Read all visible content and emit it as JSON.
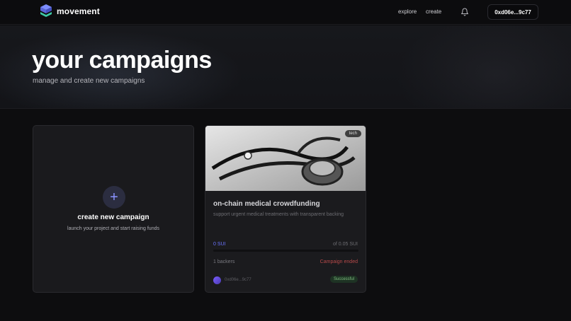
{
  "nav": {
    "brand": "movement",
    "links": [
      {
        "label": "explore"
      },
      {
        "label": "create"
      }
    ],
    "wallet": "0xd06e...9c77"
  },
  "hero": {
    "title": "your campaigns",
    "subtitle": "manage and create new campaigns"
  },
  "create_card": {
    "title": "create new campaign",
    "subtitle": "launch your project and start raising funds",
    "icon": "plus-icon"
  },
  "campaigns": [
    {
      "tag": "tech",
      "image": "stethoscope-photo",
      "title": "on-chain medical crowdfunding",
      "description": "support urgent medical treatments with transparent backing",
      "raised": "0 SUI",
      "goal": "of 0.05 SUI",
      "progress": 0,
      "backers": "1 backers",
      "status": "Campaign ended",
      "creator": "0xd06e...9c77",
      "badge": "Successful"
    }
  ],
  "colors": {
    "accent": "#6b74ff",
    "ended": "#b84a4a",
    "success": "#7fbf7f"
  }
}
